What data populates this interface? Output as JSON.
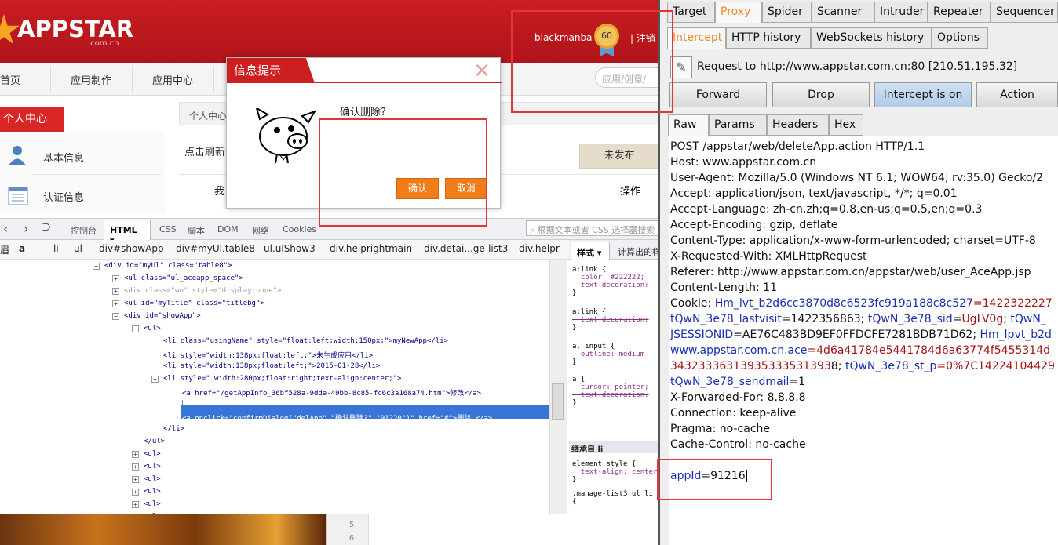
{
  "site": {
    "logo": "APPSTAR",
    "logo_sub": ".com.cn",
    "user": "blackmanba",
    "level": "60",
    "logout": "| 注销",
    "nav": [
      "首页",
      "应用制作",
      "应用中心"
    ],
    "search_placeholder": "应用/创意/",
    "side_title": "个人中心",
    "side_items": [
      "基本信息",
      "认证信息"
    ],
    "tab_label": "个人中心",
    "refresh": "点击刷新",
    "unpublished": "未发布",
    "col_me": "我",
    "col_op": "操作"
  },
  "dialog": {
    "title": "信息提示",
    "message": "确认删除?",
    "ok": "确认",
    "cancel": "取消"
  },
  "devtools": {
    "tabs": [
      "控制台",
      "HTML",
      "CSS",
      "脚本",
      "DOM",
      "网络",
      "Cookies"
    ],
    "search_placeholder": "根据文本或者 CSS 选择器搜索",
    "crumbs": [
      "a",
      "li",
      "ul",
      "div#showApp",
      "div#myUl.table8",
      "ul.ulShow3",
      "div.helprightmain",
      "div.detai...ge-list3",
      "div.helpr"
    ],
    "code": [
      {
        "i": 0,
        "t": "<div id=\"myUl\" class=\"table8\">"
      },
      {
        "i": 1,
        "t": "<ul class=\"ul_aceapp_space\">"
      },
      {
        "i": 1,
        "t": "<div class=\"wo\" style=\"display:none\">"
      },
      {
        "i": 1,
        "t": "<ul id=\"myTitle\" class=\"titlebg\">"
      },
      {
        "i": 1,
        "t": "<div id=\"showApp\">"
      },
      {
        "i": 2,
        "t": "<ul>"
      },
      {
        "i": 3,
        "t": "<li class=\"usingName\" style=\"float:left;width:150px;\">myNewApp</li>"
      },
      {
        "i": 3,
        "t": "<li style=\"width:138px;float:left;\">未生成应用</li>"
      },
      {
        "i": 3,
        "t": "<li style=\"width:138px;float:left;\">2015-01-28</li>"
      },
      {
        "i": 3,
        "t": "<li style=\" width:280px;float:right;text-align:center;\">"
      },
      {
        "i": 4,
        "t": "<a href=\"/getAppInfo_36bf528a-9dde-49bb-8c85-fc6c3a168a74.htm\">修改</a>"
      },
      {
        "i": 4,
        "t": ""
      },
      {
        "i": 4,
        "t": "<a onclick=\"confirmDialog(\"delApp\",\"确认删除?\",\"91220\")\" href=\"#\">删除 </a>"
      },
      {
        "i": 3,
        "t": "</li>"
      },
      {
        "i": 2,
        "t": "</ul>"
      },
      {
        "i": 2,
        "t": "<ul>"
      },
      {
        "i": 2,
        "t": "<ul>"
      },
      {
        "i": 2,
        "t": "<ul>"
      },
      {
        "i": 2,
        "t": "<ul>"
      },
      {
        "i": 2,
        "t": "<ul>"
      },
      {
        "i": 2,
        "t": "<ul>"
      }
    ],
    "style_tabs": {
      "style": "样式",
      "computed": "计算出的样式"
    },
    "styles": [
      "a:link {",
      "  color: #222222;",
      "  text-decoration:",
      "}",
      "a:link {",
      "  text-decoration:",
      "}",
      "a, input {",
      "  outline: medium",
      "}",
      "a {",
      "  cursor: pointer;",
      "  text-decoration:",
      "}"
    ],
    "inherit": "继承自 li",
    "styles2": [
      "element.style {",
      "  text-align: center",
      "}",
      ".manage-list3 ul li",
      "{"
    ],
    "gutter": [
      "5",
      "6"
    ]
  },
  "burp": {
    "top_tabs": [
      "Target",
      "Proxy",
      "Spider",
      "Scanner",
      "Intruder",
      "Repeater",
      "Sequencer"
    ],
    "sub_tabs": [
      "Intercept",
      "HTTP history",
      "WebSockets history",
      "Options"
    ],
    "request_line": "Request to http://www.appstar.com.cn:80  [210.51.195.32]",
    "buttons": [
      "Forward",
      "Drop",
      "Intercept is on",
      "Action"
    ],
    "view_tabs": [
      "Raw",
      "Params",
      "Headers",
      "Hex"
    ],
    "body": [
      "POST /appstar/web/deleteApp.action HTTP/1.1",
      "Host: www.appstar.com.cn",
      "User-Agent: Mozilla/5.0 (Windows NT 6.1; WOW64; rv:35.0) Gecko/2",
      "Accept: application/json, text/javascript, */*; q=0.01",
      "Accept-Language: zh-cn,zh;q=0.8,en-us;q=0.5,en;q=0.3",
      "Accept-Encoding: gzip, deflate",
      "Content-Type: application/x-www-form-urlencoded; charset=UTF-8",
      "X-Requested-With: XMLHttpRequest",
      "Referer: http://www.appstar.com.cn/appstar/web/user_AceApp.jsp",
      "Content-Length: 11"
    ],
    "cookie": [
      [
        [
          "Cookie: ",
          ""
        ],
        [
          "Hm_lvt_b2d6cc3870d8c6523fc919a188c8c527",
          "bl"
        ],
        [
          "=1422322227",
          "rd"
        ]
      ],
      [
        [
          "tQwN_3e78_lastvisit",
          "bl"
        ],
        [
          "=1422356863; ",
          ""
        ],
        [
          "tQwN_3e78_sid",
          "bl"
        ],
        [
          "=",
          ""
        ],
        [
          "UgLV0g",
          "rd"
        ],
        [
          "; ",
          ""
        ],
        [
          "tQwN_",
          "bl"
        ]
      ],
      [
        [
          "JSESSIONID",
          "bl"
        ],
        [
          "=AE76C483BD9EF0FFDCFE7281BDB71D62; ",
          ""
        ],
        [
          "Hm_lpvt_b2d",
          "bl"
        ]
      ],
      [
        [
          "www.appstar.com.cn.ace",
          "bl"
        ],
        [
          "=4d6a41784e5441784d6a63774f5455314d",
          "rd"
        ]
      ],
      [
        [
          "34323336313935333531393",
          "rd"
        ],
        [
          "8; ",
          ""
        ],
        [
          "tQwN_3e78_st_p",
          "bl"
        ],
        [
          "=0%7C14224104429",
          "rd"
        ]
      ],
      [
        [
          "tQwN_3e78_sendmail",
          "bl"
        ],
        [
          "=1",
          ""
        ]
      ]
    ],
    "body2": [
      "X-Forwarded-For: 8.8.8.8",
      "Connection: keep-alive",
      "Pragma: no-cache",
      "Cache-Control: no-cache"
    ],
    "param_key": "appId",
    "param_val": "=91216"
  }
}
